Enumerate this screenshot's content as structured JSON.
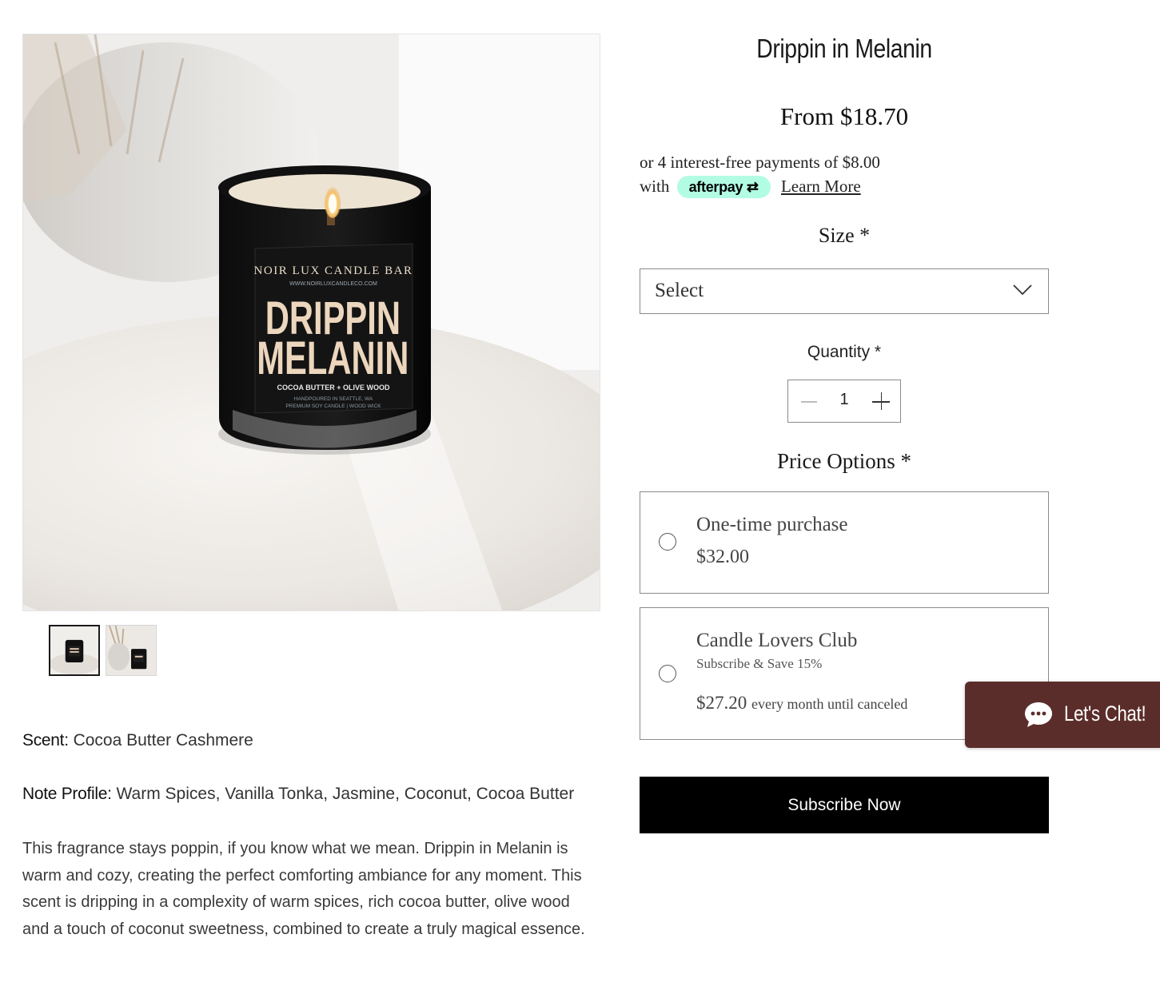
{
  "product": {
    "title": "Drippin in Melanin",
    "price": "From $18.70",
    "afterpay": {
      "text_line1": "or 4 interest-free payments of $8.00",
      "with": "with",
      "badge": "afterpay",
      "learn_more": "Learn More"
    },
    "size": {
      "label": "Size *",
      "selected": "Select"
    },
    "quantity": {
      "label": "Quantity *",
      "value": "1"
    },
    "price_options": {
      "label": "Price Options *",
      "options": [
        {
          "name": "One-time purchase",
          "price": "$32.00"
        },
        {
          "name": "Candle Lovers Club",
          "subtitle": "Subscribe & Save 15%",
          "price": "$27.20",
          "frequency": "every month until canceled"
        }
      ]
    },
    "cta": "Subscribe Now"
  },
  "image": {
    "label_brand": "NOIR LUX CANDLE BAR",
    "label_url": "WWW.NOIRLUXCANDLECO.COM",
    "label_line1": "DRIPPIN",
    "label_line2": "MELANIN",
    "label_notes": "COCOA BUTTER + OLIVE WOOD",
    "label_foot1": "HANDPOURED IN SEATTLE, WA",
    "label_foot2": "PREMIUM SOY CANDLE | WOOD WICK"
  },
  "description": {
    "scent_label": "Scent:",
    "scent_value": "Cocoa Butter Cashmere",
    "notes_label": "Note Profile:",
    "notes_value": "Warm Spices, Vanilla Tonka, Jasmine, Coconut, Cocoa Butter",
    "paragraph": "This fragrance stays poppin, if you know what we mean. Drippin in Melanin is warm and cozy, creating the perfect comforting ambiance for any moment. This scent is dripping in a complexity of warm spices, rich cocoa butter, olive wood and a touch of coconut sweetness, combined to create a truly magical essence."
  },
  "chat": {
    "label": "Let's Chat!"
  },
  "colors": {
    "afterpay_mint": "#b2fce4",
    "chat_bg": "#5b2d2a",
    "cta_bg": "#000000"
  }
}
